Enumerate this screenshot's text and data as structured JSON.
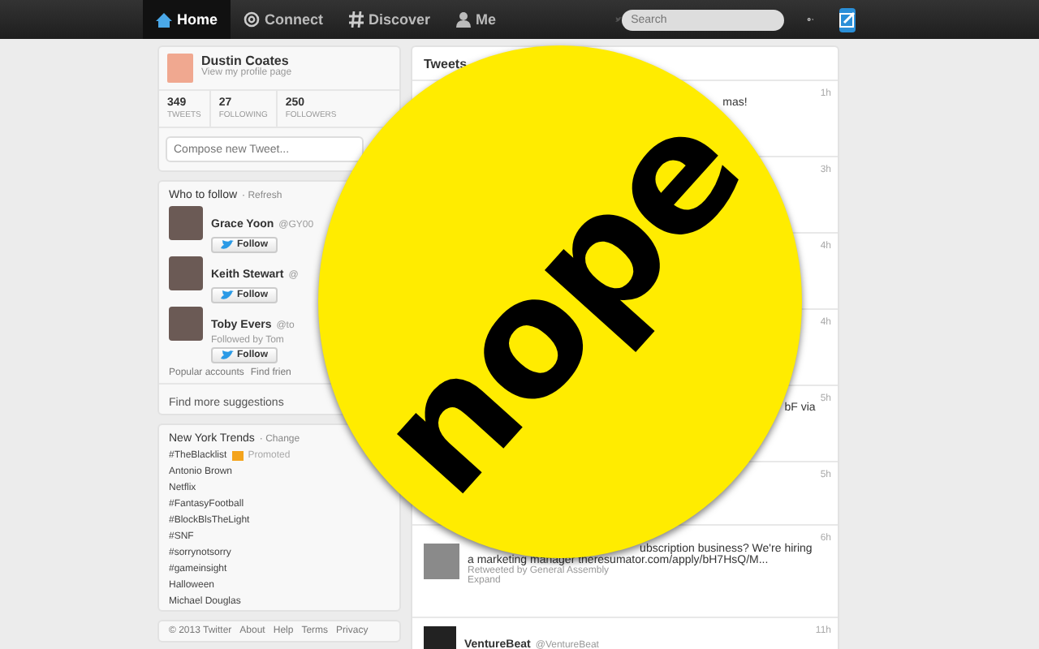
{
  "nav": {
    "items": [
      {
        "label": "Home",
        "selected": true
      },
      {
        "label": "Connect",
        "selected": false
      },
      {
        "label": "Discover",
        "selected": false
      },
      {
        "label": "Me",
        "selected": false
      }
    ],
    "search": {
      "placeholder": "Search"
    }
  },
  "profile": {
    "name": "Dustin Coates",
    "link": "View my profile page",
    "stats": [
      {
        "value": "349",
        "label": "TWEETS"
      },
      {
        "value": "27",
        "label": "FOLLOWING"
      },
      {
        "value": "250",
        "label": "FOLLOWERS"
      }
    ],
    "compose": {
      "placeholder": "Compose new Tweet..."
    }
  },
  "who_to_follow": {
    "title": "Who to follow",
    "refresh": "· Refresh",
    "people": [
      {
        "name": "Grace Yoon",
        "handle": "@GY00",
        "button": "Follow"
      },
      {
        "name": "Keith Stewart",
        "handle": "@",
        "button": "Follow"
      },
      {
        "name": "Toby Evers",
        "handle": "@to",
        "followed_by": "Followed by Tom",
        "button": "Follow"
      }
    ],
    "links": [
      "Popular accounts",
      "Find frien"
    ],
    "more": "Find more suggestions"
  },
  "trends": {
    "title": "New York Trends",
    "change": "· Change",
    "items": [
      {
        "label": "#TheBlacklist",
        "promoted": "Promoted"
      },
      {
        "label": "Antonio Brown"
      },
      {
        "label": "Netflix"
      },
      {
        "label": "#FantasyFootball"
      },
      {
        "label": "#BlockBlsTheLight"
      },
      {
        "label": "#SNF"
      },
      {
        "label": "#sorrynotsorry"
      },
      {
        "label": "#gameinsight"
      },
      {
        "label": "Halloween"
      },
      {
        "label": "Michael Douglas"
      }
    ]
  },
  "footer": [
    "© 2013 Twitter",
    "About",
    "Help",
    "Terms",
    "Privacy"
  ],
  "tweets": {
    "title": "Tweets",
    "items": [
      {
        "time": "1h",
        "fragment": "mas!"
      },
      {
        "time": "3h"
      },
      {
        "time": "4h"
      },
      {
        "time": "4h"
      },
      {
        "time": "5h",
        "fragment": "bF via"
      },
      {
        "time": "5h"
      },
      {
        "time": "6h",
        "avatar": true,
        "lines": [
          "ubscription business?  We're hiring",
          "a marketing manager  theresumator.com/apply/bH7HsQ/M..."
        ],
        "retweeted": "Retweeted by General Assembly",
        "expand": "Expand"
      },
      {
        "time": "11h",
        "logo": true,
        "name": "VentureBeat",
        "handle": "@VentureBeat"
      }
    ]
  },
  "overlay": {
    "text": "nope"
  }
}
